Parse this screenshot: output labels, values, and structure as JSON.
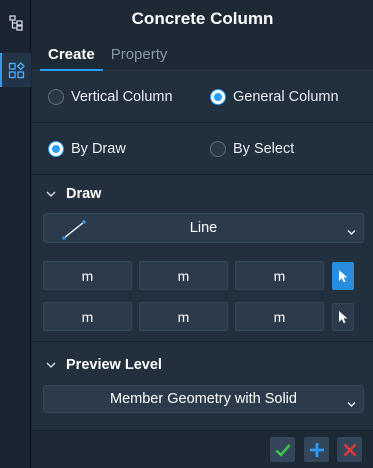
{
  "window": {
    "title": "Concrete Column"
  },
  "rail": {
    "items": [
      {
        "icon": "tree-icon",
        "active": false
      },
      {
        "icon": "component-grid-icon",
        "active": true
      }
    ]
  },
  "tabs": [
    {
      "label": "Create",
      "active": true
    },
    {
      "label": "Property",
      "active": false
    }
  ],
  "column_type": {
    "options": [
      {
        "label": "Vertical Column",
        "selected": false
      },
      {
        "label": "General Column",
        "selected": true
      }
    ]
  },
  "input_mode": {
    "options": [
      {
        "label": "By Draw",
        "selected": true
      },
      {
        "label": "By Select",
        "selected": false
      }
    ]
  },
  "draw": {
    "heading": "Draw",
    "shape_select": {
      "value": "Line",
      "icon": "line-tool-icon"
    },
    "point_rows": [
      {
        "values": [
          "m",
          "m",
          "m"
        ],
        "pick_active": true
      },
      {
        "values": [
          "m",
          "m",
          "m"
        ],
        "pick_active": false
      }
    ]
  },
  "preview_level": {
    "heading": "Preview Level",
    "select": {
      "value": "Member Geometry with Solid"
    }
  },
  "footer": {
    "buttons": [
      "confirm-check-icon",
      "add-plus-icon",
      "cancel-x-icon"
    ]
  },
  "colors": {
    "accent": "#2a9df4",
    "confirm": "#3cc04a",
    "cancel": "#e03a3a",
    "panel": "#22303e"
  }
}
